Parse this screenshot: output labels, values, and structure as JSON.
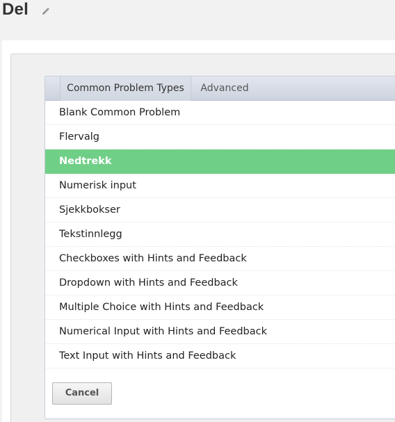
{
  "unit": {
    "title": "Del"
  },
  "problem_types": {
    "tabs": [
      {
        "label": "Common Problem Types",
        "active": true
      },
      {
        "label": "Advanced",
        "active": false
      }
    ],
    "items": [
      {
        "label": "Blank Common Problem",
        "selected": false
      },
      {
        "label": "Flervalg",
        "selected": false
      },
      {
        "label": "Nedtrekk",
        "selected": true
      },
      {
        "label": "Numerisk input",
        "selected": false
      },
      {
        "label": "Sjekkbokser",
        "selected": false
      },
      {
        "label": "Tekstinnlegg",
        "selected": false
      },
      {
        "label": "Checkboxes with Hints and Feedback",
        "selected": false
      },
      {
        "label": "Dropdown with Hints and Feedback",
        "selected": false
      },
      {
        "label": "Multiple Choice with Hints and Feedback",
        "selected": false
      },
      {
        "label": "Numerical Input with Hints and Feedback",
        "selected": false
      },
      {
        "label": "Text Input with Hints and Feedback",
        "selected": false
      }
    ],
    "cancel_label": "Cancel"
  },
  "colors": {
    "selected_item": "#70cf87",
    "tab_bar": "#cdd3de",
    "page_background": "#f2f2f2"
  },
  "icons": {
    "edit": "pencil-icon"
  }
}
